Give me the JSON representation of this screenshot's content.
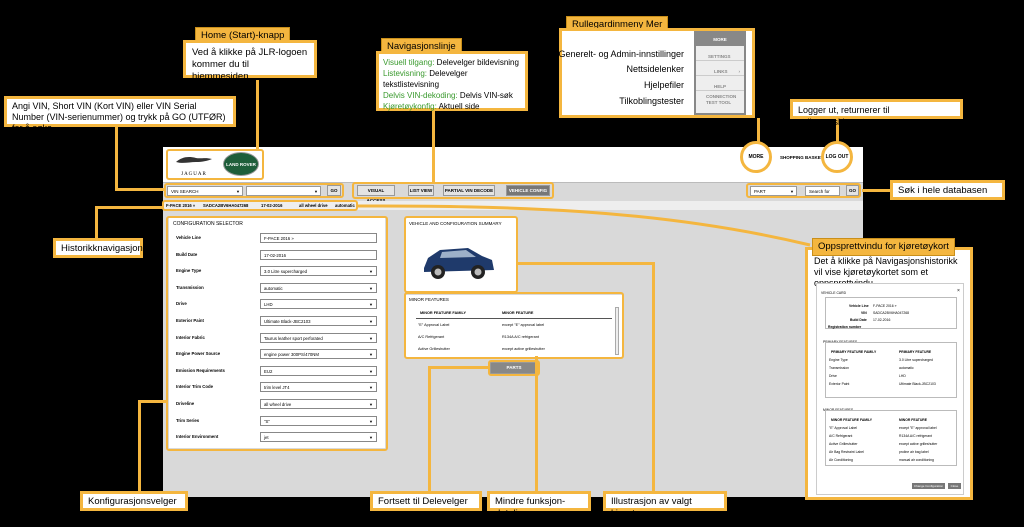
{
  "callouts": {
    "home_title": "Home (Start)-knapp",
    "home_text": "Ved å klikke på JLR-logoen kommer du til hjemmesiden",
    "vin_text": "Angi VIN, Short VIN (Kort VIN) eller VIN Serial Number (VIN-serienummer) og trykk på GO (UTFØR) for å søke",
    "nav_title": "Navigasjonslinje",
    "nav_lines": [
      {
        "key": "Visuell tilgang:",
        "desc": " Delevelger bildevisning"
      },
      {
        "key": "Listevisning:",
        "desc": " Delevelger tekstlistevisning"
      },
      {
        "key": "Delvis VIN-dekoding:",
        "desc": " Delvis VIN-søk"
      },
      {
        "key": "Kjøretøykonfig:",
        "desc": " Aktuell side"
      }
    ],
    "more_title": "Rullegardinmeny Mer",
    "more_labels": [
      "Generelt- og Admin-innstillinger",
      "Nettsidelenker",
      "Hjelpefiler",
      "Tilkoblingstester"
    ],
    "logout_text": "Logger ut, returnerer til velkomstskjermen",
    "search_db": "Søk i hele databasen",
    "history": "Historikknavigasjon",
    "popup_title": "Oppsprettvindu for kjøretøykort",
    "popup_text": "Det å klikke på Navigasjonshistorikk vil vise kjøretøykortet som et oppsprettvindu",
    "config_selector": "Konfigurasjonsvelger",
    "continue": "Fortsett til Delevelger",
    "minor": "Mindre funksjon-detaljer",
    "illustration": "Illustrasjon av valgt kjøretøy"
  },
  "more_menu": {
    "header": "MORE",
    "items": [
      "SETTINGS",
      "LINKS",
      "HELP",
      "CONNECTION TEST TOOL"
    ]
  },
  "header": {
    "jaguar": "JAGUAR",
    "landrover": "LAND ROVER",
    "more": "MORE",
    "basket": "SHOPPING BASKET",
    "logout": "LOG OUT"
  },
  "toolbar": {
    "vin_search": "VIN SEARCH",
    "go": "GO",
    "tabs": [
      "VISUAL ACCESS",
      "LIST VIEW",
      "PARTIAL VIN DECODE",
      "VEHICLE CONFIG"
    ],
    "part": "PART",
    "search_placeholder": "Search for",
    "go2": "GO"
  },
  "breadcrumb": [
    "F-PACE 2016 »",
    "SADCA2BV6HA047268",
    "17-02-2016",
    "all wheel drive",
    "automatic"
  ],
  "config": {
    "title": "CONFIGURATION SELECTOR",
    "rows": [
      {
        "label": "Vehicle Line",
        "value": "F-PACE 2016 »",
        "select": false
      },
      {
        "label": "Build Date",
        "value": "17-02-2016",
        "select": false
      },
      {
        "label": "Engine Type",
        "value": "3.0 Litre supercharged",
        "select": true
      },
      {
        "label": "Transmission",
        "value": "automatic",
        "select": true
      },
      {
        "label": "Drive",
        "value": "LHD",
        "select": true
      },
      {
        "label": "Exterior Paint",
        "value": "Ultimate Black-JBC2103",
        "select": true
      },
      {
        "label": "Interior Fabric",
        "value": "Taurus leather sport perforated",
        "select": true
      },
      {
        "label": "Engine Power Source",
        "value": "engine power 300PS/470NM",
        "select": true
      },
      {
        "label": "Emission Requirements",
        "value": "EU2",
        "select": true
      },
      {
        "label": "Interior Trim Code",
        "value": "trim level JT4",
        "select": true
      },
      {
        "label": "Driveline",
        "value": "all wheel drive",
        "select": true
      },
      {
        "label": "Trim Series",
        "value": "\"S\"",
        "select": true
      },
      {
        "label": "Interior Environment",
        "value": "jet",
        "select": true
      }
    ]
  },
  "summary": {
    "title": "VEHICLE AND CONFIGURATION SUMMARY"
  },
  "minor_features": {
    "title": "MINOR FEATURES",
    "headers": [
      "MINOR FEATURE FAMILY",
      "MINOR FEATURE"
    ],
    "rows": [
      [
        "\"E\" Approval Label",
        "except \"E\" approval label"
      ],
      [
        "A/C Refrigerant",
        "R134A A/C refrigerant"
      ],
      [
        "Active Grilleshutter",
        "except active grilleshutter"
      ]
    ],
    "parts_button": "PARTS"
  },
  "vehicle_card": {
    "title": "VEHICLE CARD",
    "fields": [
      [
        "Vehicle Line",
        "F-PACE 2016 »"
      ],
      [
        "VIN",
        "SADCA2BV6HA047268"
      ],
      [
        "Build Date",
        "17-02-2016"
      ],
      [
        "Registration number",
        ""
      ]
    ],
    "primary_title": "PRIMARY FEATURES",
    "primary_headers": [
      "PRIMARY FEATURE FAMILY",
      "PRIMARY FEATURE"
    ],
    "primary_rows": [
      [
        "Engine Type",
        "3.0 Litre supercharged"
      ],
      [
        "Transmission",
        "automatic"
      ],
      [
        "Drive",
        "LHD"
      ],
      [
        "Exterior Paint",
        "Ultimate Black-JBC2103"
      ]
    ],
    "minor_title": "MINOR FEATURES",
    "minor_headers": [
      "MINOR FEATURE FAMILY",
      "MINOR FEATURE"
    ],
    "minor_rows": [
      [
        "\"E\" Approval Label",
        "except \"E\" approval label"
      ],
      [
        "A/C Refrigerant",
        "R134A A/C refrigerant"
      ],
      [
        "Active Grilleshutter",
        "except active grilleshutter"
      ],
      [
        "Air Bag Restraint Label",
        "proline air bag label"
      ],
      [
        "Air Conditioning",
        "manual air conditioning"
      ]
    ],
    "btn_change": "Change Configuration",
    "btn_close": "Close"
  },
  "colors": {
    "callout": "#f4b63f",
    "green": "#3a9a2e"
  }
}
